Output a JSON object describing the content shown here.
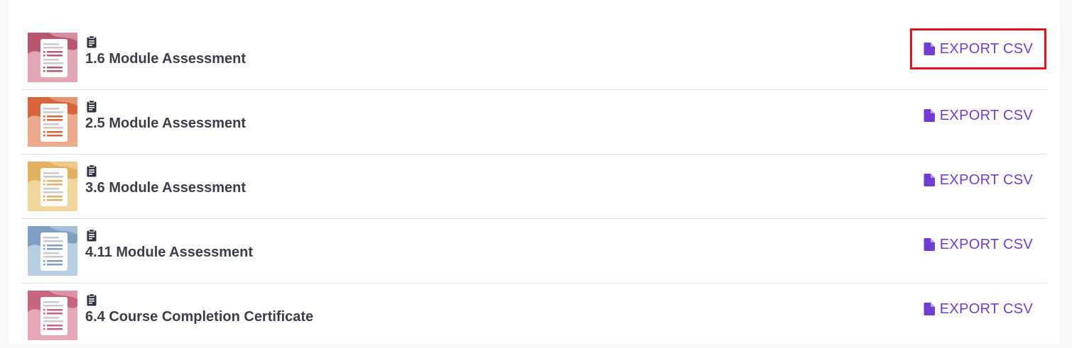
{
  "rows": [
    {
      "title": "1.6 Module Assessment",
      "action_label": "EXPORT CSV",
      "thumb_color": "#b95670",
      "thumb_light": "#e8b5c0",
      "type_icon": "clipboard-icon",
      "highlighted": true
    },
    {
      "title": "2.5 Module Assessment",
      "action_label": "EXPORT CSV",
      "thumb_color": "#d8643a",
      "thumb_light": "#f0b59a",
      "type_icon": "clipboard-icon",
      "highlighted": false
    },
    {
      "title": "3.6 Module Assessment",
      "action_label": "EXPORT CSV",
      "thumb_color": "#e3b062",
      "thumb_light": "#f4dba8",
      "type_icon": "clipboard-icon",
      "highlighted": false
    },
    {
      "title": "4.11 Module Assessment",
      "action_label": "EXPORT CSV",
      "thumb_color": "#7c9fc2",
      "thumb_light": "#c3d5e6",
      "type_icon": "clipboard-icon",
      "highlighted": false
    },
    {
      "title": "6.4 Course Completion Certificate",
      "action_label": "EXPORT CSV",
      "thumb_color": "#c8657e",
      "thumb_light": "#eab4c2",
      "type_icon": "clipboard-icon",
      "highlighted": false
    }
  ],
  "colors": {
    "accent": "#6f3ed1",
    "highlight_box": "#e0121d",
    "title_text": "#3b3d4a",
    "divider": "#e3e3e6"
  },
  "icons": {
    "export": "file-icon",
    "item_type": "clipboard-icon"
  }
}
